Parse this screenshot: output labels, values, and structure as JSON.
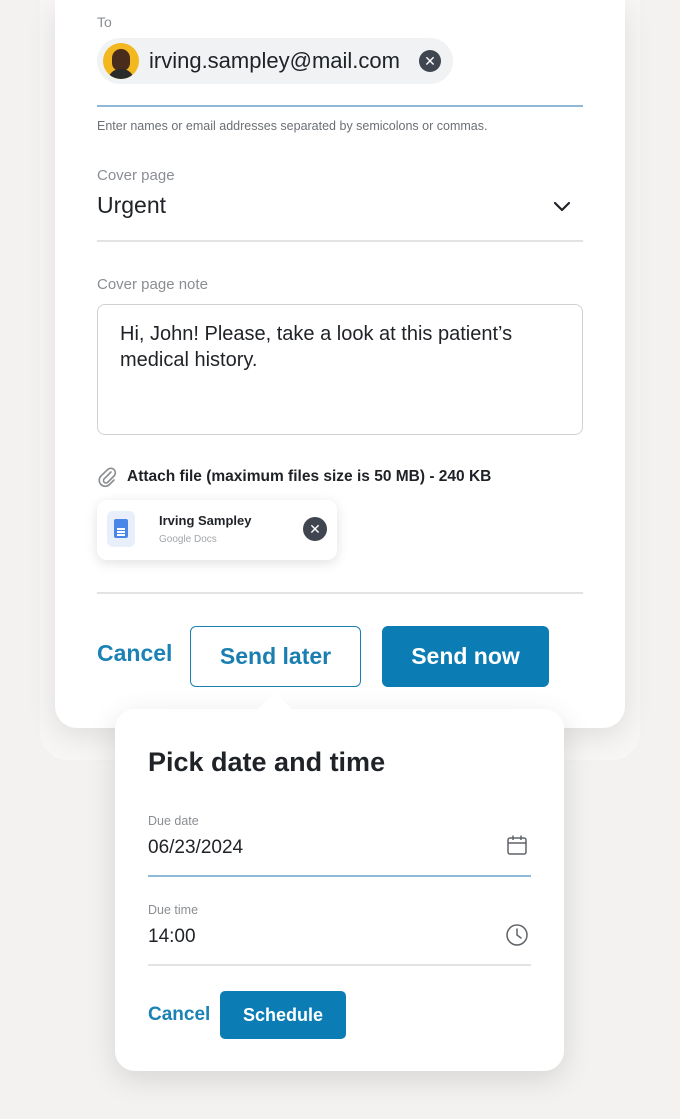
{
  "recipients": {
    "label": "To",
    "chip_email": "irving.sampley@mail.com",
    "hint": "Enter names or email addresses separated by semicolons or commas."
  },
  "cover_page": {
    "label": "Cover page",
    "selected": "Urgent"
  },
  "cover_note": {
    "label": "Cover page note",
    "value": "Hi, John! Please, take a look at this patient’s medical history."
  },
  "attachment": {
    "label": "Attach file (maximum files size is 50 MB) - 240 KB",
    "file_name": "Irving Sampley",
    "file_source": "Google Docs"
  },
  "actions": {
    "cancel": "Cancel",
    "send_later": "Send later",
    "send_now": "Send now"
  },
  "schedule_popover": {
    "title": "Pick date and time",
    "due_date_label": "Due date",
    "due_date_value": "06/23/2024",
    "due_time_label": "Due time",
    "due_time_value": "14:00",
    "cancel": "Cancel",
    "schedule": "Schedule"
  },
  "colors": {
    "accent": "#0c7db4",
    "link": "#1a82b5",
    "focus_underline": "#8fb9d6"
  }
}
